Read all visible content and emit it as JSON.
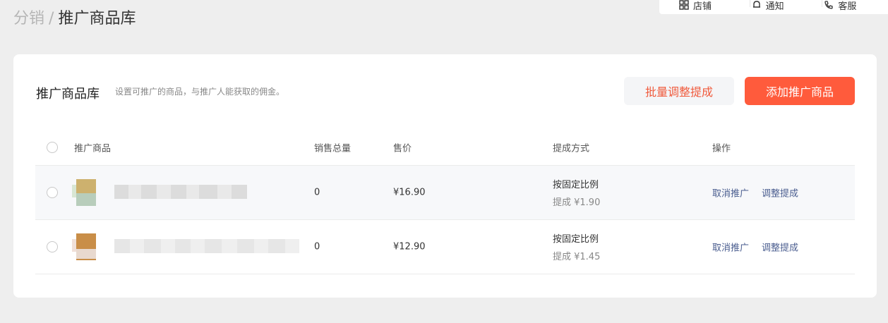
{
  "breadcrumb": {
    "parent": "分销",
    "separator": "/",
    "current": "推广商品库"
  },
  "topbar": {
    "items": [
      {
        "label": "店铺",
        "icon": "store-icon"
      },
      {
        "label": "通知",
        "icon": "bell-icon"
      },
      {
        "label": "客服",
        "icon": "phone-icon"
      }
    ]
  },
  "card": {
    "title": "推广商品库",
    "description": "设置可推广的商品，与推广人能获取的佣金。",
    "batch_button": "批量调整提成",
    "add_button": "添加推广商品"
  },
  "table": {
    "headers": {
      "product": "推广商品",
      "sales": "销售总量",
      "price": "售价",
      "commission": "提成方式",
      "ops": "操作"
    },
    "rows": [
      {
        "sales": "0",
        "price": "¥16.90",
        "commission_type": "按固定比例",
        "commission_amount": "提成 ¥1.90",
        "op_cancel": "取消推广",
        "op_adjust": "调整提成"
      },
      {
        "sales": "0",
        "price": "¥12.90",
        "commission_type": "按固定比例",
        "commission_amount": "提成 ¥1.45",
        "op_cancel": "取消推广",
        "op_adjust": "调整提成"
      }
    ]
  },
  "colors": {
    "accent": "#ff5b3c",
    "link": "#4a5d8f",
    "background": "#eeeeee"
  }
}
